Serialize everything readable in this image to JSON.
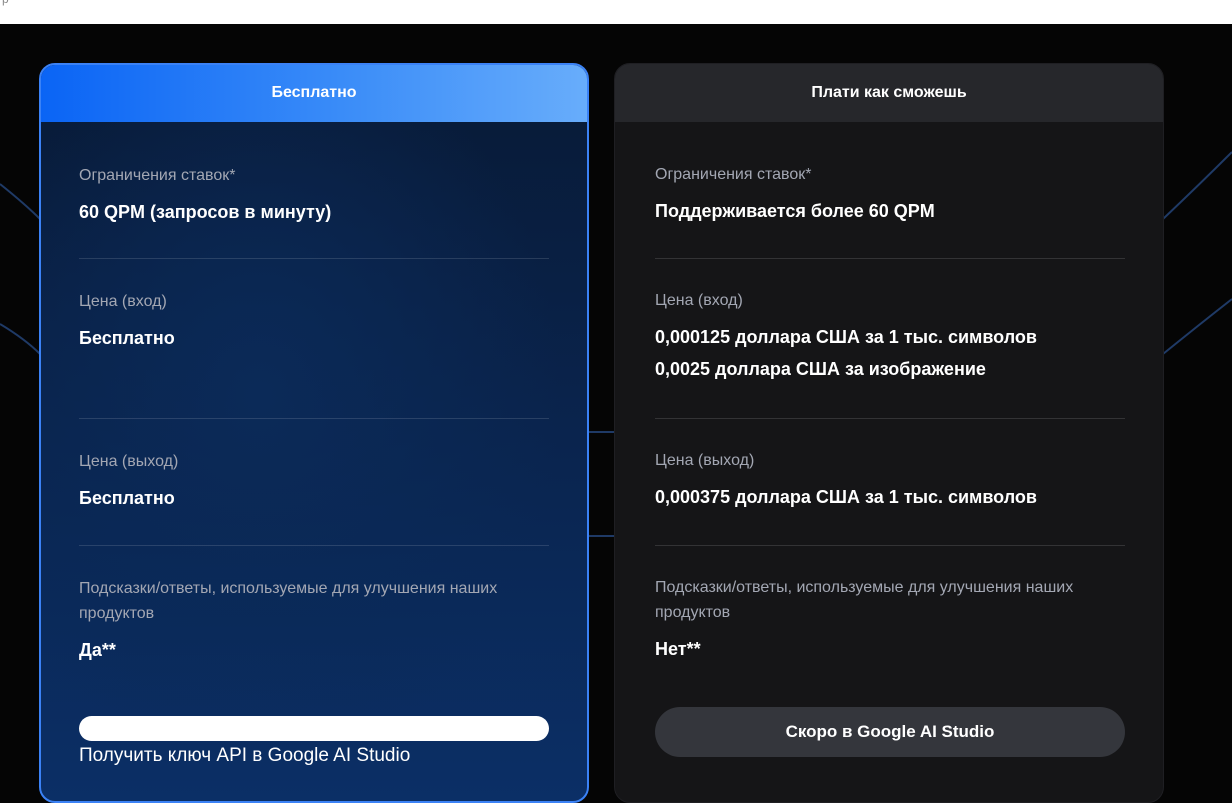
{
  "top_fragment": "р",
  "free_plan": {
    "header": "Бесплатно",
    "rate_limits": {
      "label": "Ограничения ставок*",
      "value": "60 QPM (запросов в минуту)"
    },
    "price_input": {
      "label": "Цена (вход)",
      "value": "Бесплатно"
    },
    "price_output": {
      "label": "Цена (выход)",
      "value": "Бесплатно"
    },
    "data_usage": {
      "label": "Подсказки/ответы, используемые для улучшения наших продуктов",
      "value": "Да**"
    },
    "cta_label": "Получить ключ API в Google AI Studio"
  },
  "paid_plan": {
    "header": "Плати как сможешь",
    "rate_limits": {
      "label": "Ограничения ставок*",
      "value": "Поддерживается более 60 QPM"
    },
    "price_input": {
      "label": "Цена (вход)",
      "value_line1": "0,000125 доллара США за 1 тыс. символов",
      "value_line2": "0,0025 доллара США за изображение"
    },
    "price_output": {
      "label": "Цена (выход)",
      "value": "0,000375 доллара США за 1 тыс. символов"
    },
    "data_usage": {
      "label": "Подсказки/ответы, используемые для улучшения наших продуктов",
      "value": "Нет**"
    },
    "cta_label": "Скоро в Google AI Studio"
  },
  "colors": {
    "accent_blue": "#0a64f5",
    "page_background": "#050505",
    "paid_card_background": "#151517"
  }
}
